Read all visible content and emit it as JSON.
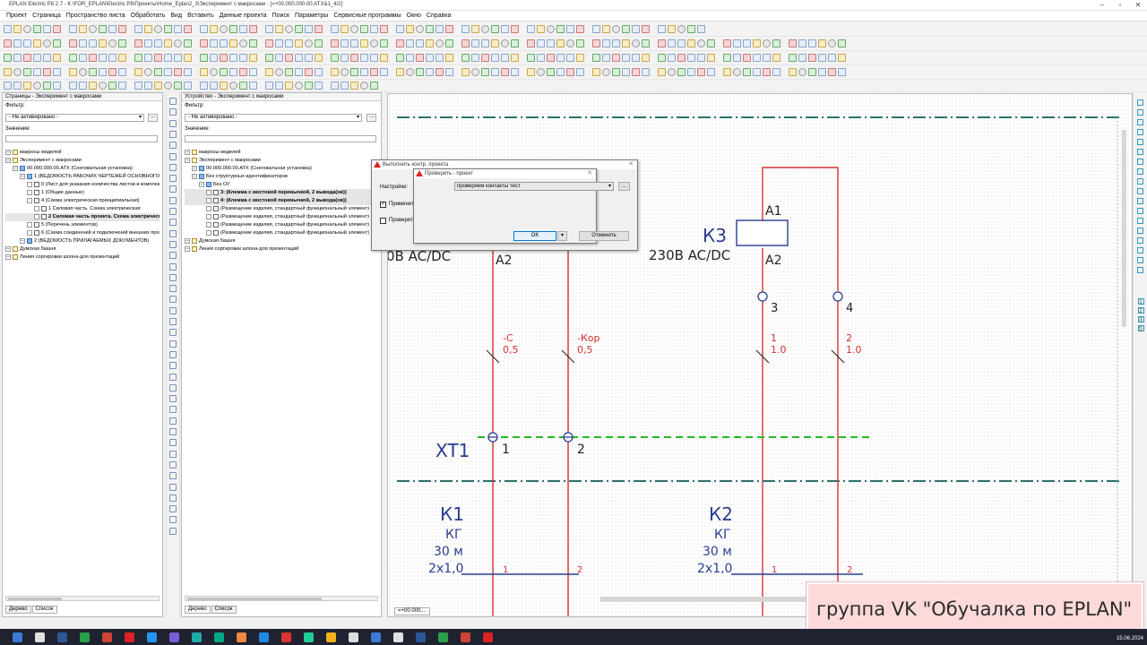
{
  "window": {
    "title": "EPLAN Electric P8 2.7 - K:\\FOR_EPLAN\\Electric P8\\Проекты\\Home_Eplan2_3\\Эксперимент с макросами - [=+00.000.000.00.ATX&1_4/2]"
  },
  "menu": [
    "Проект",
    "Страница",
    "Пространство листа",
    "Обработать",
    "Вид",
    "Вставить",
    "Данные проекта",
    "Поиск",
    "Параметры",
    "Сервисные программы",
    "Окно",
    "Справка"
  ],
  "left_panel": {
    "title": "Страницы - Эксперимент с макросами",
    "filter_label": "Фильтр:",
    "filter_value": "- Не активировано -",
    "value_label": "Значение:",
    "tree": [
      {
        "t": "макросы моделей",
        "lvl": 0
      },
      {
        "t": "Эксперимент с макросами",
        "lvl": 0
      },
      {
        "t": "00.000.000.00.АТХ (Снеговалъная установка)",
        "lvl": 1
      },
      {
        "t": "1 (ВЕДОМОСТЬ РАБОЧИХ ЧЕРТЕЖЕЙ ОСНОВНОГО КОМПЛЕКТА)",
        "lvl": 2
      },
      {
        "t": "0 (Лист для указания количества листов в комплекте)",
        "lvl": 3
      },
      {
        "t": "1 (Общие данные)",
        "lvl": 3
      },
      {
        "t": "4 (Схема электрическая  принципиальная)",
        "lvl": 3
      },
      {
        "t": "1 Силовая часть. Схема электрическая",
        "lvl": 4
      },
      {
        "t": "2 Силовая часть проекта. Схема электрическая",
        "lvl": 4,
        "bold": true
      },
      {
        "t": "5 (Перечень элементов)",
        "lvl": 3
      },
      {
        "t": "6 (Схема соединений и подключений внешних проводок)",
        "lvl": 3
      },
      {
        "t": "2 (ВЕДОМОСТЬ ПРИЛАГАЕМЫХ ДОКУМЕНТОВ)",
        "lvl": 2
      },
      {
        "t": "Думская башня",
        "lvl": 0
      },
      {
        "t": "Линия сортировки шпона-для презентаций",
        "lvl": 0
      }
    ],
    "tabs": [
      "Дерево",
      "Список"
    ]
  },
  "mid_panel": {
    "title": "Устройство - Эксперимент с макросами",
    "filter_label": "Фильтр:",
    "filter_value": "- Не активировано -",
    "value_label": "Значение:",
    "tree": [
      {
        "t": "макросы моделей",
        "lvl": 0
      },
      {
        "t": "Эксперимент с макросами",
        "lvl": 0
      },
      {
        "t": "00.000.000.00.АТХ (Снеговалъная установка)",
        "lvl": 1
      },
      {
        "t": "Без структурных идентификаторов",
        "lvl": 1
      },
      {
        "t": "Без ОУ",
        "lvl": 2
      },
      {
        "t": "3: (Клемма с мостовой перемычкой, 2 вывода(ов))",
        "lvl": 3,
        "bold": true
      },
      {
        "t": "4: (Клемма с мостовой перемычкой, 2 вывода(ов))",
        "lvl": 3,
        "bold": true
      },
      {
        "t": "(Размещение изделия, стандартный функциональный элемент)",
        "lvl": 3
      },
      {
        "t": "(Размещение изделия, стандартный функциональный элемент)",
        "lvl": 3
      },
      {
        "t": "(Размещение изделия, стандартный функциональный элемент)",
        "lvl": 3
      },
      {
        "t": "(Размещение изделия, стандартный функциональный элемент)",
        "lvl": 3
      },
      {
        "t": "Думская башня",
        "lvl": 0
      },
      {
        "t": "Линия сортировки шпона-для презентаций",
        "lvl": 0
      }
    ],
    "tabs": [
      "Дерево",
      "Список"
    ]
  },
  "dialog_back": {
    "title": "Выполнить контр. проекта",
    "settings_label": "Настройки:",
    "check_all": "Применить ко всему проекту",
    "check_only": "Проверять только выполненные сообщения"
  },
  "dialog_front": {
    "title": "Проверить - проект",
    "settings_value": "проверяем контакты тест",
    "ok": "OK",
    "cancel": "Отменить"
  },
  "schematic": {
    "k3_label": "К3",
    "k3_voltage": "230В AC/DC",
    "left_voltage": "0В AC/DC",
    "a1": "A1",
    "a2": "A2",
    "a2_left": "A2",
    "t3": "3",
    "t4": "4",
    "w1_name": "-С",
    "w1_size": "0,5",
    "w2_name": "-Кор",
    "w2_size": "0,5",
    "w3_name": "1",
    "w3_size": "1.0",
    "w4_name": "2",
    "w4_size": "1.0",
    "xt1": "XT1",
    "xt1_p1": "1",
    "xt1_p2": "2",
    "k1": {
      "name": "К1",
      "type": "КГ",
      "len": "30 м",
      "sec": "2х1,0",
      "c1": "1",
      "c2": "2"
    },
    "k2": {
      "name": "К2",
      "type": "КГ",
      "len": "30 м",
      "sec": "2х1,0",
      "c1": "1",
      "c2": "2"
    }
  },
  "page_tab": "=+00.000....",
  "right_numbers": [
    "1",
    "2",
    "3",
    "5"
  ],
  "banner": "группа VK  \"Обучалка по EPLAN\"",
  "taskbar": {
    "date": "15.06.2024"
  }
}
